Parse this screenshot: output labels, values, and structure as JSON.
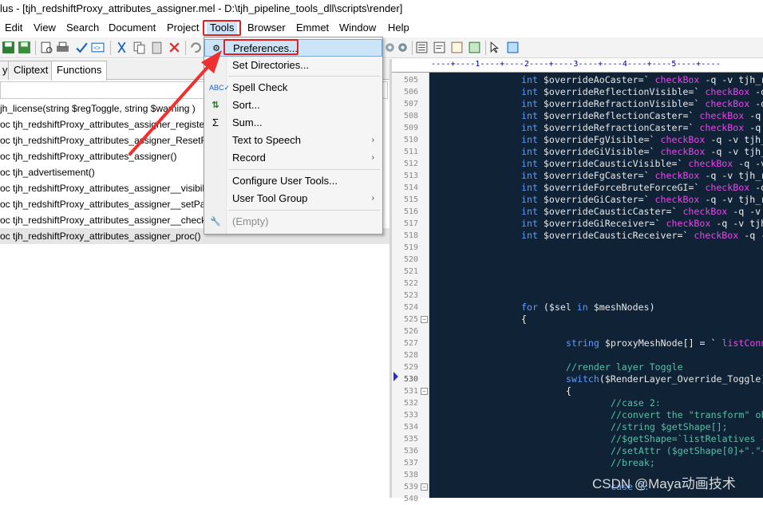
{
  "title": "lus - [tjh_redshiftProxy_attributes_assigner.mel - D:\\tjh_pipeline_tools_dll\\scripts\\render]",
  "menubar": [
    "Edit",
    "View",
    "Search",
    "Document",
    "Project",
    "Tools",
    "Browser",
    "Emmet",
    "Window",
    "Help"
  ],
  "tabs": [
    "y",
    "Cliptext",
    "Functions"
  ],
  "functions": [
    "jh_license(string $regToggle, string $warning )",
    "oc tjh_redshiftProxy_attributes_assigner_register()",
    "oc tjh_redshiftProxy_attributes_assigner_ResetRe",
    "oc tjh_redshiftProxy_attributes_assigner()",
    "oc tjh_advertisement()",
    "oc tjh_redshiftProxy_attributes_assigner__visibili",
    "oc  tjh_redshiftProxy_attributes_assigner__setPat",
    "oc tjh_redshiftProxy_attributes_assigner__checkBo",
    "oc tjh_redshiftProxy_attributes_assigner_proc()"
  ],
  "ruler": "----+----1----+----2----+----3----+----4----+----5----+----",
  "dropdown": {
    "items": [
      {
        "label": "Preferences...",
        "icon": "gear-icon",
        "arrow": ""
      },
      {
        "label": "Set Directories...",
        "icon": "",
        "arrow": ""
      },
      {
        "label": "Spell Check",
        "icon": "spellcheck-icon",
        "arrow": ""
      },
      {
        "label": "Sort...",
        "icon": "sort-icon",
        "arrow": ""
      },
      {
        "label": "Sum...",
        "icon": "sigma-icon",
        "arrow": ""
      },
      {
        "label": "Text to Speech",
        "icon": "",
        "arrow": "›"
      },
      {
        "label": "Record",
        "icon": "",
        "arrow": "›"
      },
      {
        "label": "Configure User Tools...",
        "icon": "",
        "arrow": ""
      },
      {
        "label": "User Tool Group",
        "icon": "",
        "arrow": "›"
      },
      {
        "label": "(Empty)",
        "icon": "wrench-icon",
        "arrow": ""
      }
    ]
  },
  "code": {
    "lines": [
      {
        "n": "505",
        "t": [
          [
            "kw",
            "int "
          ],
          [
            "var",
            "$overrideAoCaster"
          ],
          [
            "wt",
            "=` "
          ],
          [
            "fnc",
            "checkBox"
          ],
          [
            "wt",
            " -q -v tjh_r"
          ]
        ]
      },
      {
        "n": "506",
        "t": [
          [
            "kw",
            "int "
          ],
          [
            "var",
            "$overrideReflectionVisible"
          ],
          [
            "wt",
            "=` "
          ],
          [
            "fnc",
            "checkBox"
          ],
          [
            "wt",
            " -q"
          ]
        ]
      },
      {
        "n": "507",
        "t": [
          [
            "kw",
            "int "
          ],
          [
            "var",
            "$overrideRefractionVisible"
          ],
          [
            "wt",
            "=` "
          ],
          [
            "fnc",
            "checkBox"
          ],
          [
            "wt",
            " -q"
          ]
        ]
      },
      {
        "n": "508",
        "t": [
          [
            "kw",
            "int "
          ],
          [
            "var",
            "$overrideReflectionCaster"
          ],
          [
            "wt",
            "=` "
          ],
          [
            "fnc",
            "checkBox"
          ],
          [
            "wt",
            " -q"
          ]
        ]
      },
      {
        "n": "509",
        "t": [
          [
            "kw",
            "int "
          ],
          [
            "var",
            "$overrideRefractionCaster"
          ],
          [
            "wt",
            "=` "
          ],
          [
            "fnc",
            "checkBox"
          ],
          [
            "wt",
            " -q"
          ]
        ]
      },
      {
        "n": "510",
        "t": [
          [
            "kw",
            "int "
          ],
          [
            "var",
            "$overrideFgVisible"
          ],
          [
            "wt",
            "=` "
          ],
          [
            "fnc",
            "checkBox"
          ],
          [
            "wt",
            " -q -v tjh_"
          ]
        ]
      },
      {
        "n": "511",
        "t": [
          [
            "kw",
            "int "
          ],
          [
            "var",
            "$overrideGiVisible"
          ],
          [
            "wt",
            "=` "
          ],
          [
            "fnc",
            "checkBox"
          ],
          [
            "wt",
            " -q -v tjh_"
          ]
        ]
      },
      {
        "n": "512",
        "t": [
          [
            "kw",
            "int "
          ],
          [
            "var",
            "$overrideCausticVisible"
          ],
          [
            "wt",
            "=` "
          ],
          [
            "fnc",
            "checkBox"
          ],
          [
            "wt",
            " -q -v"
          ]
        ]
      },
      {
        "n": "513",
        "t": [
          [
            "kw",
            "int "
          ],
          [
            "var",
            "$overrideFgCaster"
          ],
          [
            "wt",
            "=` "
          ],
          [
            "fnc",
            "checkBox"
          ],
          [
            "wt",
            " -q -v tjh_r"
          ]
        ]
      },
      {
        "n": "514",
        "t": [
          [
            "kw",
            "int "
          ],
          [
            "var",
            "$overrideForceBruteForceGI"
          ],
          [
            "wt",
            "=` "
          ],
          [
            "fnc",
            "checkBox"
          ],
          [
            "wt",
            " -q"
          ]
        ]
      },
      {
        "n": "515",
        "t": [
          [
            "kw",
            "int "
          ],
          [
            "var",
            "$overrideGiCaster"
          ],
          [
            "wt",
            "=` "
          ],
          [
            "fnc",
            "checkBox"
          ],
          [
            "wt",
            " -q -v tjh_r"
          ]
        ]
      },
      {
        "n": "516",
        "t": [
          [
            "kw",
            "int "
          ],
          [
            "var",
            "$overrideCausticCaster"
          ],
          [
            "wt",
            "=` "
          ],
          [
            "fnc",
            "checkBox"
          ],
          [
            "wt",
            " -q -v"
          ]
        ]
      },
      {
        "n": "517",
        "t": [
          [
            "kw",
            "int "
          ],
          [
            "var",
            "$overrideGiReceiver"
          ],
          [
            "wt",
            "=` "
          ],
          [
            "fnc",
            "checkBox"
          ],
          [
            "wt",
            " -q -v tjh"
          ]
        ]
      },
      {
        "n": "518",
        "t": [
          [
            "kw",
            "int "
          ],
          [
            "var",
            "$overrideCausticReceiver"
          ],
          [
            "wt",
            "=` "
          ],
          [
            "fnc",
            "checkBox"
          ],
          [
            "wt",
            " -q -"
          ]
        ]
      },
      {
        "n": "519",
        "t": []
      },
      {
        "n": "520",
        "t": []
      },
      {
        "n": "521",
        "t": []
      },
      {
        "n": "522",
        "t": []
      },
      {
        "n": "523",
        "t": []
      },
      {
        "n": "524",
        "t": [
          [
            "kw",
            "for "
          ],
          [
            "wt",
            "("
          ],
          [
            "var",
            "$sel"
          ],
          [
            "kw",
            " in "
          ],
          [
            "var",
            "$meshNodes"
          ],
          [
            "wt",
            ")"
          ]
        ]
      },
      {
        "n": "525",
        "t": [
          [
            "wt",
            "{"
          ]
        ]
      },
      {
        "n": "526",
        "t": []
      },
      {
        "n": "527",
        "t": [
          [
            "kw",
            "string "
          ],
          [
            "var",
            "$proxyMeshNode"
          ],
          [
            "wt",
            "[] = ` "
          ],
          [
            "fnc",
            "listConn"
          ]
        ]
      },
      {
        "n": "528",
        "t": []
      },
      {
        "n": "529",
        "t": [
          [
            "cmt",
            "//render layer Toggle"
          ]
        ]
      },
      {
        "n": "530",
        "t": [
          [
            "kw",
            "switch"
          ],
          [
            "wt",
            "("
          ],
          [
            "var",
            "$RenderLayer_Override_Toggle"
          ],
          [
            "wt",
            ")"
          ]
        ]
      },
      {
        "n": "531",
        "t": [
          [
            "wt",
            "{"
          ]
        ]
      },
      {
        "n": "532",
        "t": [
          [
            "cmt",
            "//case 2:"
          ]
        ]
      },
      {
        "n": "533",
        "t": [
          [
            "cmt",
            "//convert the \"transform\" ob"
          ]
        ]
      },
      {
        "n": "534",
        "t": [
          [
            "cmt",
            "//string $getShape[];"
          ]
        ]
      },
      {
        "n": "535",
        "t": [
          [
            "cmt",
            "//$getShape=`listRelatives -"
          ]
        ]
      },
      {
        "n": "536",
        "t": [
          [
            "cmt",
            "//setAttr ($getShape[0]+\".\"+"
          ]
        ]
      },
      {
        "n": "537",
        "t": [
          [
            "cmt",
            "//break;"
          ]
        ]
      },
      {
        "n": "538",
        "t": []
      },
      {
        "n": "539",
        "t": [
          [
            "kw",
            "case 1:"
          ]
        ]
      },
      {
        "n": "540",
        "t": []
      }
    ]
  },
  "watermark": "CSDN @Maya动画技术",
  "colors": {
    "editor_bg": "#0f2236",
    "keyword": "#5d9cff",
    "function": "#ee44ee",
    "comment": "#56c0a6",
    "highlight": "#cce4f7",
    "annotation": "#e02020"
  }
}
